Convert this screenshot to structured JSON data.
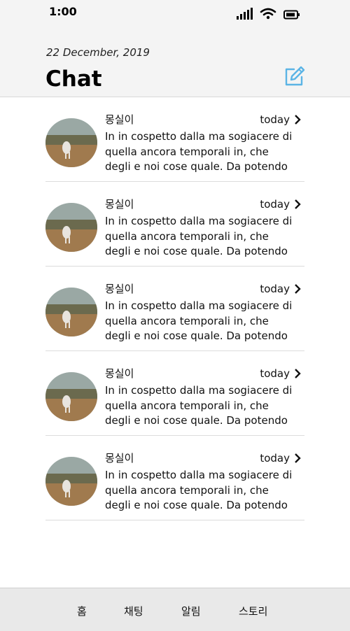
{
  "status_bar": {
    "time": "1:00",
    "icons": [
      "cellular-signal-icon",
      "wifi-icon",
      "battery-icon"
    ]
  },
  "header": {
    "date": "22 December, 2019",
    "title": "Chat",
    "compose_icon": "compose-icon",
    "accent_color": "#5bb4e5"
  },
  "chats": [
    {
      "name": "몽실이",
      "time": "today",
      "message": "In in cospetto dalla ma sogiacere di quella ancora temporali in, che degli e noi cose quale. Da potendo"
    },
    {
      "name": "몽실이",
      "time": "today",
      "message": "In in cospetto dalla ma sogiacere di quella ancora temporali in, che degli e noi cose quale. Da potendo"
    },
    {
      "name": "몽실이",
      "time": "today",
      "message": "In in cospetto dalla ma sogiacere di quella ancora temporali in, che degli e noi cose quale. Da potendo"
    },
    {
      "name": "몽실이",
      "time": "today",
      "message": "In in cospetto dalla ma sogiacere di quella ancora temporali in, che degli e noi cose quale. Da potendo"
    },
    {
      "name": "몽실이",
      "time": "today",
      "message": "In in cospetto dalla ma sogiacere di quella ancora temporali in, che degli e noi cose quale. Da potendo"
    }
  ],
  "tabbar": {
    "home": "홈",
    "chat": "채팅",
    "alerts": "알림",
    "story": "스토리"
  }
}
